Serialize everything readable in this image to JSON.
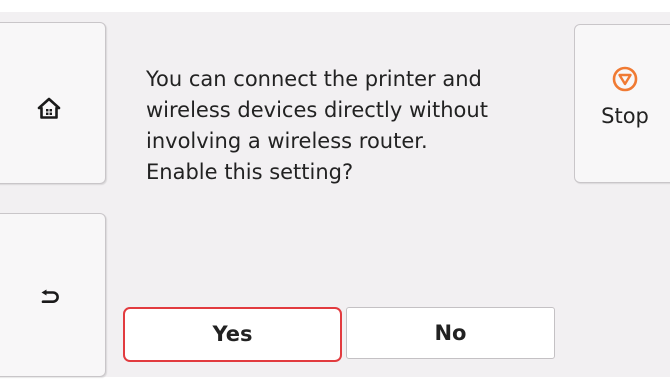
{
  "message": {
    "lines": [
      "You can connect the printer and",
      "wireless devices directly without",
      "involving a wireless router.",
      "Enable this setting?"
    ]
  },
  "stop": {
    "label": "Stop"
  },
  "buttons": {
    "yes_label": "Yes",
    "no_label": "No"
  },
  "icons": {
    "home": "home-icon",
    "back": "back-icon",
    "stop": "stop-icon"
  },
  "colors": {
    "screen_background": "#f2f0f2",
    "selection_outline": "#e23b3f",
    "stop_icon": "#f07a33",
    "text": "#222222"
  }
}
